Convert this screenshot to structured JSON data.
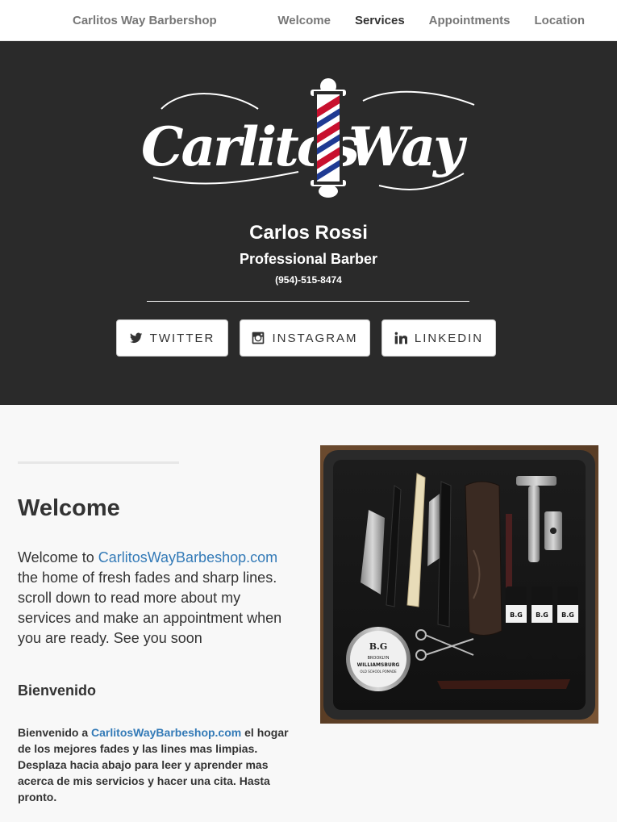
{
  "nav": {
    "brand": "Carlitos Way Barbershop",
    "links": [
      {
        "label": "Welcome"
      },
      {
        "label": "Services"
      },
      {
        "label": "Appointments"
      },
      {
        "label": "Location"
      }
    ],
    "active": "Services"
  },
  "hero": {
    "logo_text": "Carlitos Way",
    "name": "Carlos Rossi",
    "title": "Professional Barber",
    "phone": "(954)-515-8474",
    "social": [
      {
        "label": "TWITTER",
        "icon": "twitter-icon"
      },
      {
        "label": "INSTAGRAM",
        "icon": "instagram-icon"
      },
      {
        "label": "LINKEDIN",
        "icon": "linkedin-icon"
      }
    ],
    "background": "#2a2a2a"
  },
  "welcome": {
    "heading": "Welcome",
    "intro": "Welcome to ",
    "link": "CarlitosWayBarbeshop.com",
    "body": " the home of fresh fades and sharp lines. scroll down to read more about my services and make an appointment when you are ready. See you soon"
  },
  "bienvenido": {
    "heading": "Bienvenido",
    "intro": "Bienvenido a ",
    "link": "CarlitosWayBarbeshop.com",
    "body": " el hogar de los mejores fades y las lines mas limpias. Desplaza hacia abajo para leer y aprender mas acerca de mis servicios y hacer una cita. Hasta pronto."
  },
  "photo": {
    "labels": {
      "tin_brand": "B.G",
      "tin_city": "BROOKLYN",
      "tin_line": "WILLIAMSBURG",
      "tin_product": "OLD SCHOOL POMADE",
      "bottle_brand": "B.G"
    }
  },
  "colors": {
    "link": "#337ab7",
    "pole_red": "#c8102e",
    "pole_blue": "#1f3a93"
  }
}
